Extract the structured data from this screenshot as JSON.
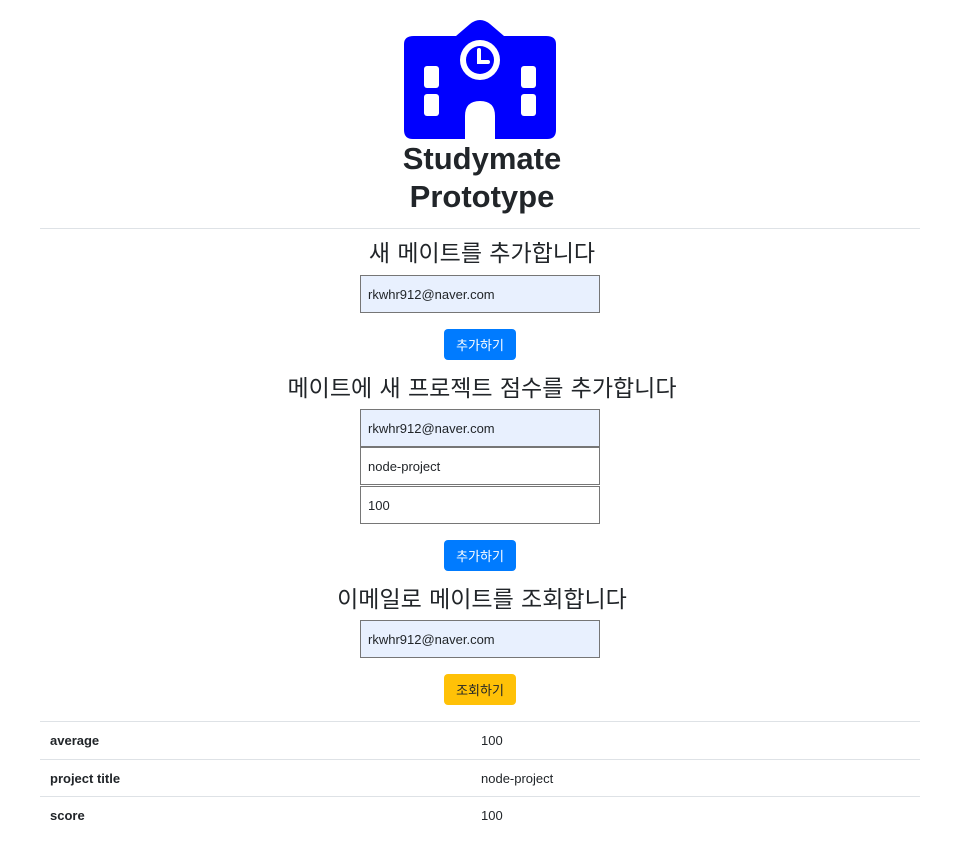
{
  "header": {
    "logo_icon": "school-building-icon",
    "title_line1": "Studymate",
    "title_line2": "Prototype",
    "logo_color": "#0000ff"
  },
  "add_mate": {
    "title": "새 메이트를 추가합니다",
    "email_value": "rkwhr912@naver.com",
    "button_label": "추가하기"
  },
  "add_score": {
    "title": "메이트에 새 프로젝트 점수를 추가합니다",
    "email_value": "rkwhr912@naver.com",
    "project_value": "node-project",
    "score_value": "100",
    "button_label": "추가하기"
  },
  "lookup": {
    "title": "이메일로 메이트를 조회합니다",
    "email_value": "rkwhr912@naver.com",
    "button_label": "조회하기"
  },
  "result_table": {
    "rows": [
      {
        "key": "average",
        "value": "100"
      },
      {
        "key": "project title",
        "value": "node-project"
      },
      {
        "key": "score",
        "value": "100"
      }
    ]
  },
  "colors": {
    "primary": "#007bff",
    "warning": "#ffc107",
    "autofill": "#e8f0fe"
  }
}
